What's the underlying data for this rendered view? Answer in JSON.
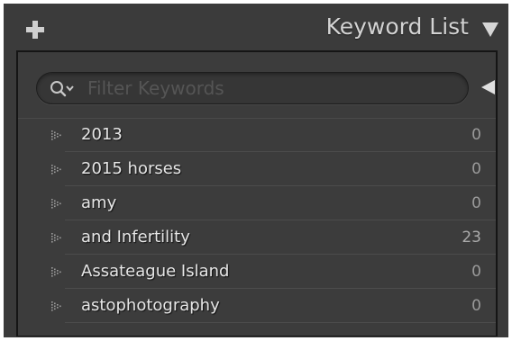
{
  "header": {
    "title": "Keyword List",
    "add_icon": "plus-icon",
    "collapse_icon": "triangle-down-icon"
  },
  "filter": {
    "placeholder": "Filter Keywords",
    "value": "",
    "search_icon": "magnifier-dropdown-icon",
    "toggle_icon": "triangle-left-icon"
  },
  "keywords": [
    {
      "name": "2013",
      "count": "0"
    },
    {
      "name": "2015 horses",
      "count": "0"
    },
    {
      "name": "amy",
      "count": "0"
    },
    {
      "name": "and Infertility",
      "count": "23"
    },
    {
      "name": "Assateague Island",
      "count": "0"
    },
    {
      "name": "astophotography",
      "count": "0"
    }
  ],
  "colors": {
    "panel_bg": "#3a3a3a",
    "text": "#e6e6e6",
    "count": "#9a9a9a",
    "title": "#d3d3d3"
  }
}
